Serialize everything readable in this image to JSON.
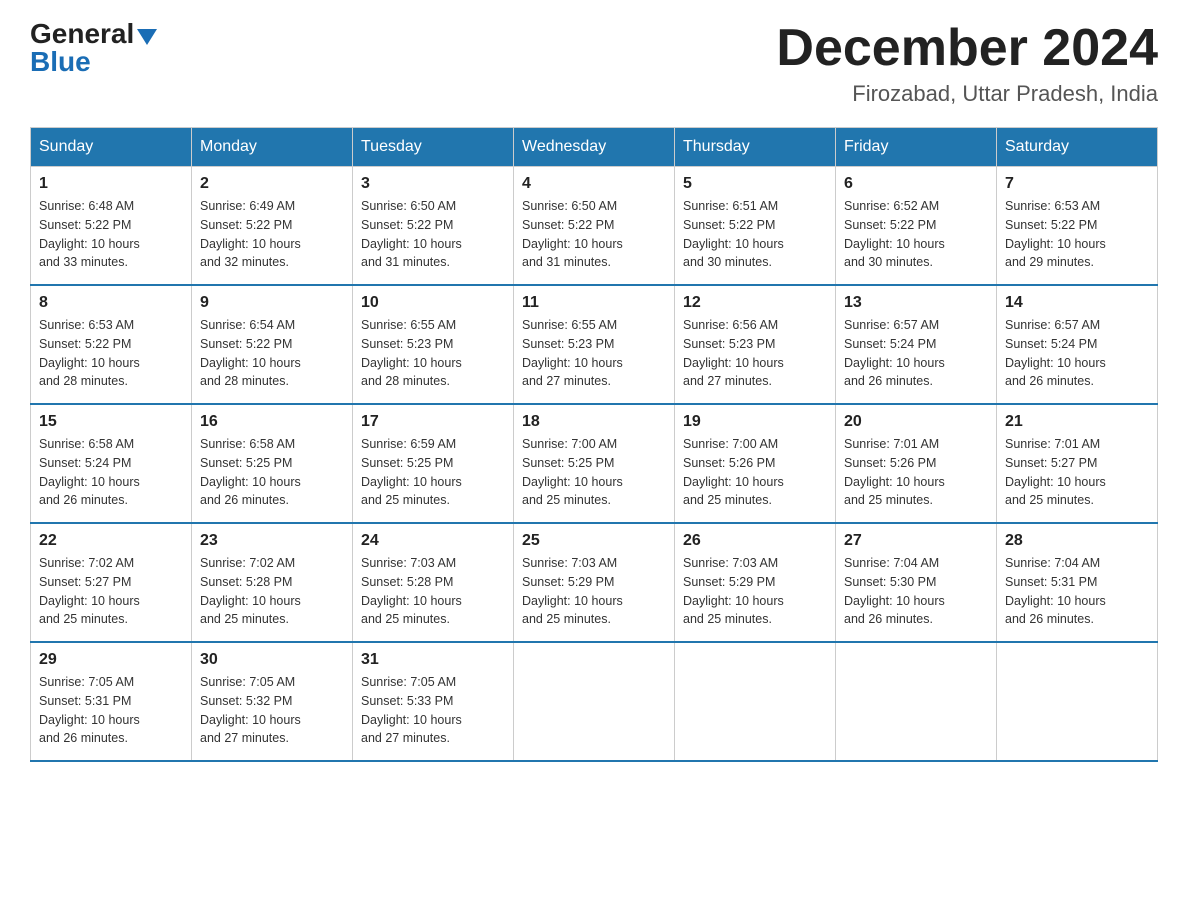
{
  "header": {
    "logo_general": "General",
    "logo_blue": "Blue",
    "month_title": "December 2024",
    "location": "Firozabad, Uttar Pradesh, India"
  },
  "days_of_week": [
    "Sunday",
    "Monday",
    "Tuesday",
    "Wednesday",
    "Thursday",
    "Friday",
    "Saturday"
  ],
  "weeks": [
    [
      {
        "day": "1",
        "sunrise": "6:48 AM",
        "sunset": "5:22 PM",
        "daylight": "10 hours and 33 minutes."
      },
      {
        "day": "2",
        "sunrise": "6:49 AM",
        "sunset": "5:22 PM",
        "daylight": "10 hours and 32 minutes."
      },
      {
        "day": "3",
        "sunrise": "6:50 AM",
        "sunset": "5:22 PM",
        "daylight": "10 hours and 31 minutes."
      },
      {
        "day": "4",
        "sunrise": "6:50 AM",
        "sunset": "5:22 PM",
        "daylight": "10 hours and 31 minutes."
      },
      {
        "day": "5",
        "sunrise": "6:51 AM",
        "sunset": "5:22 PM",
        "daylight": "10 hours and 30 minutes."
      },
      {
        "day": "6",
        "sunrise": "6:52 AM",
        "sunset": "5:22 PM",
        "daylight": "10 hours and 30 minutes."
      },
      {
        "day": "7",
        "sunrise": "6:53 AM",
        "sunset": "5:22 PM",
        "daylight": "10 hours and 29 minutes."
      }
    ],
    [
      {
        "day": "8",
        "sunrise": "6:53 AM",
        "sunset": "5:22 PM",
        "daylight": "10 hours and 28 minutes."
      },
      {
        "day": "9",
        "sunrise": "6:54 AM",
        "sunset": "5:22 PM",
        "daylight": "10 hours and 28 minutes."
      },
      {
        "day": "10",
        "sunrise": "6:55 AM",
        "sunset": "5:23 PM",
        "daylight": "10 hours and 28 minutes."
      },
      {
        "day": "11",
        "sunrise": "6:55 AM",
        "sunset": "5:23 PM",
        "daylight": "10 hours and 27 minutes."
      },
      {
        "day": "12",
        "sunrise": "6:56 AM",
        "sunset": "5:23 PM",
        "daylight": "10 hours and 27 minutes."
      },
      {
        "day": "13",
        "sunrise": "6:57 AM",
        "sunset": "5:24 PM",
        "daylight": "10 hours and 26 minutes."
      },
      {
        "day": "14",
        "sunrise": "6:57 AM",
        "sunset": "5:24 PM",
        "daylight": "10 hours and 26 minutes."
      }
    ],
    [
      {
        "day": "15",
        "sunrise": "6:58 AM",
        "sunset": "5:24 PM",
        "daylight": "10 hours and 26 minutes."
      },
      {
        "day": "16",
        "sunrise": "6:58 AM",
        "sunset": "5:25 PM",
        "daylight": "10 hours and 26 minutes."
      },
      {
        "day": "17",
        "sunrise": "6:59 AM",
        "sunset": "5:25 PM",
        "daylight": "10 hours and 25 minutes."
      },
      {
        "day": "18",
        "sunrise": "7:00 AM",
        "sunset": "5:25 PM",
        "daylight": "10 hours and 25 minutes."
      },
      {
        "day": "19",
        "sunrise": "7:00 AM",
        "sunset": "5:26 PM",
        "daylight": "10 hours and 25 minutes."
      },
      {
        "day": "20",
        "sunrise": "7:01 AM",
        "sunset": "5:26 PM",
        "daylight": "10 hours and 25 minutes."
      },
      {
        "day": "21",
        "sunrise": "7:01 AM",
        "sunset": "5:27 PM",
        "daylight": "10 hours and 25 minutes."
      }
    ],
    [
      {
        "day": "22",
        "sunrise": "7:02 AM",
        "sunset": "5:27 PM",
        "daylight": "10 hours and 25 minutes."
      },
      {
        "day": "23",
        "sunrise": "7:02 AM",
        "sunset": "5:28 PM",
        "daylight": "10 hours and 25 minutes."
      },
      {
        "day": "24",
        "sunrise": "7:03 AM",
        "sunset": "5:28 PM",
        "daylight": "10 hours and 25 minutes."
      },
      {
        "day": "25",
        "sunrise": "7:03 AM",
        "sunset": "5:29 PM",
        "daylight": "10 hours and 25 minutes."
      },
      {
        "day": "26",
        "sunrise": "7:03 AM",
        "sunset": "5:29 PM",
        "daylight": "10 hours and 25 minutes."
      },
      {
        "day": "27",
        "sunrise": "7:04 AM",
        "sunset": "5:30 PM",
        "daylight": "10 hours and 26 minutes."
      },
      {
        "day": "28",
        "sunrise": "7:04 AM",
        "sunset": "5:31 PM",
        "daylight": "10 hours and 26 minutes."
      }
    ],
    [
      {
        "day": "29",
        "sunrise": "7:05 AM",
        "sunset": "5:31 PM",
        "daylight": "10 hours and 26 minutes."
      },
      {
        "day": "30",
        "sunrise": "7:05 AM",
        "sunset": "5:32 PM",
        "daylight": "10 hours and 27 minutes."
      },
      {
        "day": "31",
        "sunrise": "7:05 AM",
        "sunset": "5:33 PM",
        "daylight": "10 hours and 27 minutes."
      },
      null,
      null,
      null,
      null
    ]
  ],
  "labels": {
    "sunrise": "Sunrise:",
    "sunset": "Sunset:",
    "daylight": "Daylight:"
  }
}
